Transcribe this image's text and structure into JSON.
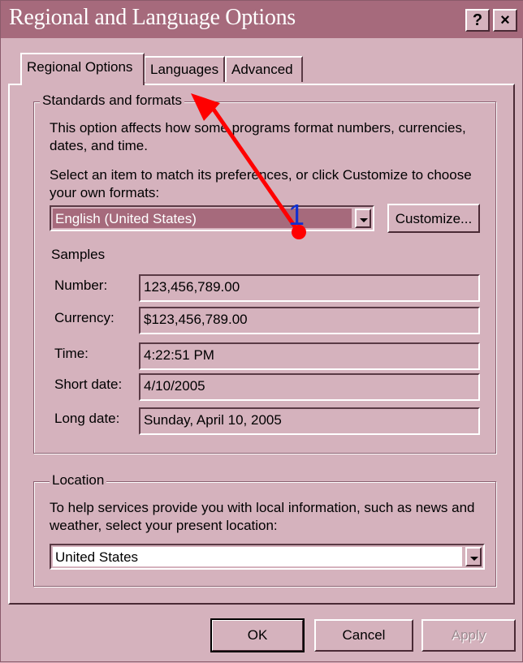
{
  "window": {
    "title": "Regional and Language Options",
    "help_button": "?",
    "close_button": "×"
  },
  "tabs": [
    {
      "label": "Regional Options"
    },
    {
      "label": "Languages"
    },
    {
      "label": "Advanced"
    }
  ],
  "standards": {
    "legend": "Standards and formats",
    "description": "This option affects how some programs format numbers, currencies, dates, and time.",
    "select_prompt": "Select an item to match its preferences, or click Customize to choose your own formats:",
    "format_value": "English (United States)",
    "customize_button": "Customize...",
    "samples_label": "Samples",
    "samples": [
      {
        "label": "Number:",
        "value": "123,456,789.00"
      },
      {
        "label": "Currency:",
        "value": "$123,456,789.00"
      },
      {
        "label": "Time:",
        "value": "4:22:51 PM"
      },
      {
        "label": "Short date:",
        "value": "4/10/2005"
      },
      {
        "label": "Long date:",
        "value": "Sunday, April 10, 2005"
      }
    ]
  },
  "location": {
    "legend": "Location",
    "description": "To help services provide you with local information, such as news and weather, select your present location:",
    "value": "United States"
  },
  "footer": {
    "ok": "OK",
    "cancel": "Cancel",
    "apply": "Apply"
  },
  "annotation": {
    "number": "1",
    "color": "#ff0000",
    "number_color": "#1030d0"
  },
  "colors": {
    "titlebar": "#a66a7c",
    "dialog": "#d5b2bd",
    "selection": "#a66a7c"
  }
}
